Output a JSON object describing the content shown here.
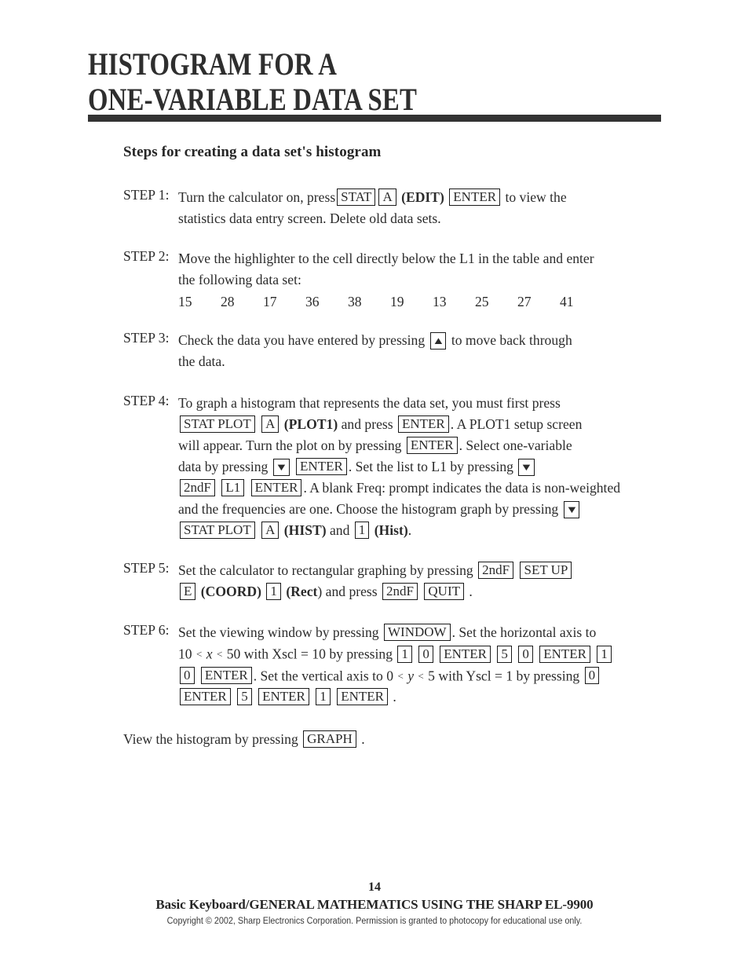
{
  "title": {
    "line1": "HISTOGRAM FOR A",
    "line2": "ONE-VARIABLE DATA SET",
    "rule_color": "#333333"
  },
  "subheading": "Steps for creating a data set's histogram",
  "steps": [
    {
      "label": "STEP 1:",
      "lines": [
        "Turn the calculator on, press",
        "statistics data entry screen.  Delete old data sets."
      ],
      "keys": [
        "STAT",
        "A",
        "ENTER"
      ],
      "bold_tokens": [
        "(EDIT)"
      ],
      "tail": "to view the"
    },
    {
      "label": "STEP 2:",
      "lines": [
        "Move the highlighter to the cell directly below the L1 in the table and enter",
        "the following data set:"
      ],
      "data_set": [
        "15",
        "28",
        "17",
        "36",
        "38",
        "19",
        "13",
        "25",
        "27",
        "41"
      ]
    },
    {
      "label": "STEP 3:",
      "lines": [
        "Check the data you have entered by pressing",
        "to move back through",
        "the data."
      ],
      "keys": [
        "▲"
      ]
    },
    {
      "label": "STEP 4:",
      "lines": [
        "To graph a histogram that represents the data set, you must first press",
        "and press",
        ".  A PLOT1 setup screen",
        "will appear.  Turn the plot on by pressing",
        ".  Select one-variable",
        "data by pressing",
        ".  Set the list to L1 by pressing",
        ".  A blank Freq: prompt indicates the data is non-weighted",
        "and the frequencies are one.  Choose the histogram graph by pressing",
        "and"
      ],
      "keys": [
        "STAT PLOT",
        "A",
        "ENTER",
        "ENTER",
        "▼",
        "ENTER",
        "▼",
        "2ndF",
        "L1",
        "ENTER",
        "▼",
        "STAT PLOT",
        "A",
        "1"
      ],
      "bold_tokens": [
        "(PLOT1)",
        "(HIST)",
        "(Hist)"
      ]
    },
    {
      "label": "STEP 5:",
      "lines": [
        "Set the calculator to rectangular graphing by pressing",
        "and press",
        "."
      ],
      "keys": [
        "2ndF",
        "SET UP",
        "E",
        "1",
        "2ndF",
        "QUIT"
      ],
      "bold_tokens": [
        "(COORD)",
        "(Rect"
      ]
    },
    {
      "label": "STEP 6:",
      "lines": [
        "Set the viewing window by pressing",
        ".  Set the horizontal axis to",
        "with Xscl = 10 by pressing",
        ".  Set the vertical axis to",
        "with Yscl = 1 by pressing",
        "."
      ],
      "keys": [
        "WINDOW",
        "1",
        "0",
        "ENTER",
        "5",
        "0",
        "ENTER",
        "1",
        "0",
        "ENTER",
        "0",
        "ENTER",
        "5",
        "ENTER",
        "1",
        "ENTER"
      ],
      "x_range": {
        "low": "10",
        "var": "x",
        "high": "50",
        "rel": "<"
      },
      "y_range": {
        "low": "0",
        "var": "y",
        "high": "5",
        "rel": "<"
      }
    }
  ],
  "closing": {
    "text_before": "View the histogram by pressing",
    "key": "GRAPH",
    "text_after": "."
  },
  "footer": {
    "page_number": "14",
    "title": "Basic Keyboard/GENERAL MATHEMATICS USING THE SHARP EL-9900",
    "copyright": "Copyright © 2002, Sharp Electronics Corporation.  Permission is granted to photocopy for educational use only."
  }
}
